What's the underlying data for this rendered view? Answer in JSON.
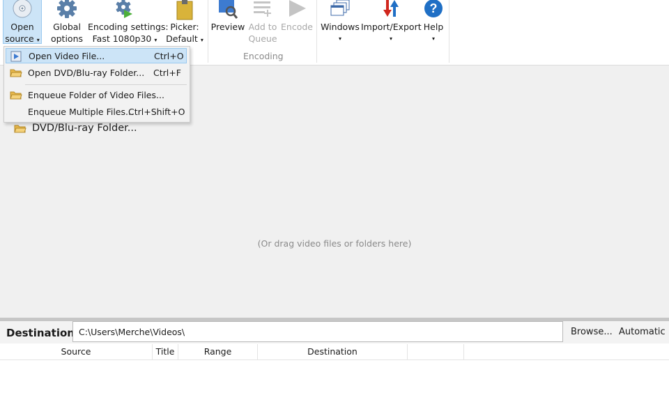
{
  "ribbon": {
    "open_source": {
      "line1": "Open",
      "line2": "source"
    },
    "global_options": {
      "line1": "Global",
      "line2": "options"
    },
    "encoding_settings": {
      "line1": "Encoding settings:",
      "line2": "Fast 1080p30"
    },
    "picker": {
      "line1": "Picker:",
      "line2": "Default"
    },
    "preview": {
      "line1": "Preview"
    },
    "add_to_queue": {
      "line1": "Add to",
      "line2": "Queue"
    },
    "encode": {
      "line1": "Encode"
    },
    "windows": {
      "line1": "Windows"
    },
    "import_export": {
      "line1": "Import/Export"
    },
    "help": {
      "line1": "Help"
    },
    "group_encoding": "Encoding",
    "dropdown_arrow": "▾"
  },
  "menu": {
    "items": [
      {
        "label": "Open Video File...",
        "shortcut": "Ctrl+O",
        "icon": "video-file-icon"
      },
      {
        "label": "Open DVD/Blu-ray Folder...",
        "shortcut": "Ctrl+F",
        "icon": "folder-icon"
      },
      {
        "label": "Enqueue Folder of Video Files...",
        "shortcut": "",
        "icon": "folder-icon"
      },
      {
        "label": "Enqueue Multiple Files...",
        "shortcut": "Ctrl+Shift+O",
        "icon": ""
      }
    ]
  },
  "main": {
    "background_item": "DVD/Blu-ray Folder...",
    "drag_hint": "(Or drag video files or folders here)"
  },
  "destination": {
    "label": "Destination:",
    "value": "C:\\Users\\Merche\\Videos\\",
    "browse": "Browse...",
    "automatic": "Automatic"
  },
  "queue_table": {
    "columns": [
      "Source",
      "Title",
      "Range",
      "Destination",
      ""
    ]
  },
  "colors": {
    "accent_blue": "#1f6fc5",
    "highlight": "#cce4f7",
    "folder_yellow": "#e8b84a",
    "import_red": "#d0261d"
  }
}
